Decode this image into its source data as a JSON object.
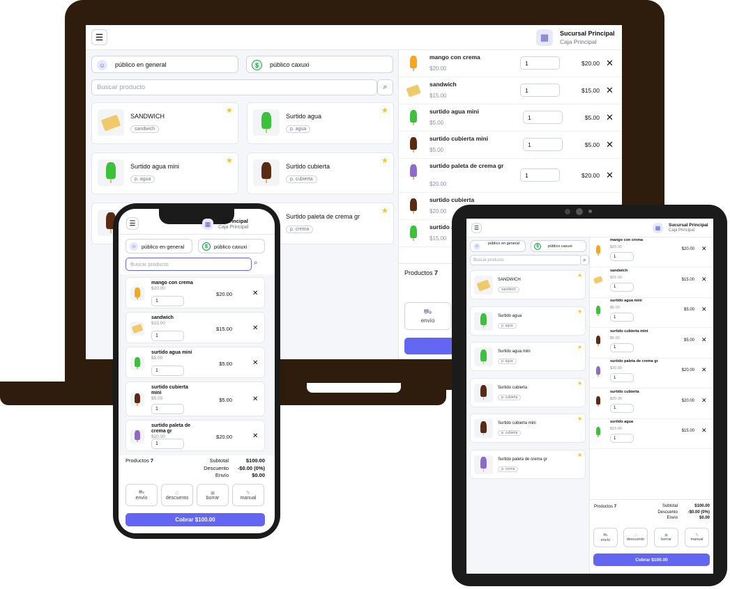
{
  "branch": {
    "name": "Sucursal Principal",
    "sub": "Caja Principal"
  },
  "clients": {
    "general": "público en general",
    "caxuxi": "público caxuxi"
  },
  "search": {
    "placeholder": "Buscar producto"
  },
  "laptop_products": [
    {
      "name": "SANDWICH",
      "tag": "sandwich",
      "kind": "sandwich"
    },
    {
      "name": "Surtido agua",
      "tag": "p. agua",
      "kind": "green"
    },
    {
      "name": "Surtido agua mini",
      "tag": "p. agua",
      "kind": "green"
    },
    {
      "name": "Surtido cubierta",
      "tag": "p. cubierta",
      "kind": "brown"
    },
    {
      "name": "",
      "tag": "",
      "kind": "brown"
    },
    {
      "name": "Surtido paleta de crema gr",
      "tag": "p. crema",
      "kind": "purple"
    }
  ],
  "laptop_cart": [
    {
      "name": "mango con crema",
      "unit": "$20.00",
      "qty": "1",
      "total": "$20.00",
      "kind": "orange"
    },
    {
      "name": "sandwich",
      "unit": "$15.00",
      "qty": "1",
      "total": "$15.00",
      "kind": "sandwich"
    },
    {
      "name": "surtido agua mini",
      "unit": "$5.00",
      "qty": "1",
      "total": "$5.00",
      "kind": "green"
    },
    {
      "name": "surtido cubierta mini",
      "unit": "$5.00",
      "qty": "1",
      "total": "$5.00",
      "kind": "brown"
    },
    {
      "name": "surtido paleta de crema gr",
      "unit": "$20.00",
      "qty": "1",
      "total": "$20.00",
      "kind": "purple"
    },
    {
      "name": "surtido cubierta",
      "unit": "$20.00",
      "qty": "",
      "total": "",
      "kind": "brown"
    },
    {
      "name": "surtido a",
      "unit": "$15.00",
      "qty": "",
      "total": "",
      "kind": "green"
    }
  ],
  "summary": {
    "products_label": "Productos",
    "products_count": "7",
    "subtotal_label": "Subtotal",
    "subtotal": "$100.00",
    "discount_label": "Descuento",
    "discount": "-$0.00 (0%)",
    "shipping_label": "Envío",
    "shipping": "$0.00"
  },
  "actions": {
    "envio": "envío",
    "descuento": "descuento",
    "borrar": "borrar",
    "manual": "manual"
  },
  "pay_label": "Cobrar $100.00",
  "phone_branch_name": "l Principal",
  "phone_cart": [
    {
      "name": "mango con crema",
      "unit": "$20.00",
      "qty": "1",
      "total": "$20.00",
      "kind": "orange"
    },
    {
      "name": "sandwich",
      "unit": "$15.00",
      "qty": "1",
      "total": "$15.00",
      "kind": "sandwich"
    },
    {
      "name": "surtido agua mini",
      "unit": "$5.00",
      "qty": "1",
      "total": "$5.00",
      "kind": "green"
    },
    {
      "name": "surtido cubierta mini",
      "unit": "$5.00",
      "qty": "1",
      "total": "$5.00",
      "kind": "brown"
    },
    {
      "name": "surtido paleta de crema gr",
      "unit": "$20.00",
      "qty": "1",
      "total": "$20.00",
      "kind": "purple"
    }
  ],
  "tablet_products": [
    {
      "name": "SANDWICH",
      "tag": "sandwich",
      "kind": "sandwich"
    },
    {
      "name": "Surtido agua",
      "tag": "p. agua",
      "kind": "green"
    },
    {
      "name": "Surtido agua mini",
      "tag": "p. agua",
      "kind": "green"
    },
    {
      "name": "Surtido cubierta",
      "tag": "p. cubierta",
      "kind": "brown"
    },
    {
      "name": "Surtido cubierta mini",
      "tag": "p. cubierta",
      "kind": "brown"
    },
    {
      "name": "Surtido paleta de crema gr",
      "tag": "p. crema",
      "kind": "purple"
    }
  ],
  "tablet_cart": [
    {
      "name": "mango con crema",
      "unit": "$20.00",
      "qty": "1",
      "total": "$20.00",
      "kind": "orange"
    },
    {
      "name": "sandwich",
      "unit": "$15.00",
      "qty": "1",
      "total": "$15.00",
      "kind": "sandwich"
    },
    {
      "name": "surtido agua mini",
      "unit": "$5.00",
      "qty": "1",
      "total": "$5.00",
      "kind": "green"
    },
    {
      "name": "surtido cubierta mini",
      "unit": "$5.00",
      "qty": "1",
      "total": "$5.00",
      "kind": "brown"
    },
    {
      "name": "surtido paleta de crema gr",
      "unit": "$20.00",
      "qty": "1",
      "total": "$20.00",
      "kind": "purple"
    },
    {
      "name": "surtido cubierta",
      "unit": "$20.00",
      "qty": "1",
      "total": "$20.00",
      "kind": "brown"
    },
    {
      "name": "surtido agua",
      "unit": "$15.00",
      "qty": "1",
      "total": "$15.00",
      "kind": "green"
    }
  ],
  "colors": {
    "accent": "#6366f1",
    "frame": "#2e1d0d",
    "star": "#f5c518"
  },
  "icons": [
    "menu-icon",
    "store-icon",
    "users-icon",
    "dollar-icon",
    "search-icon",
    "star-icon",
    "close-icon",
    "truck-icon",
    "tag-icon",
    "trash-icon",
    "hand-icon"
  ]
}
